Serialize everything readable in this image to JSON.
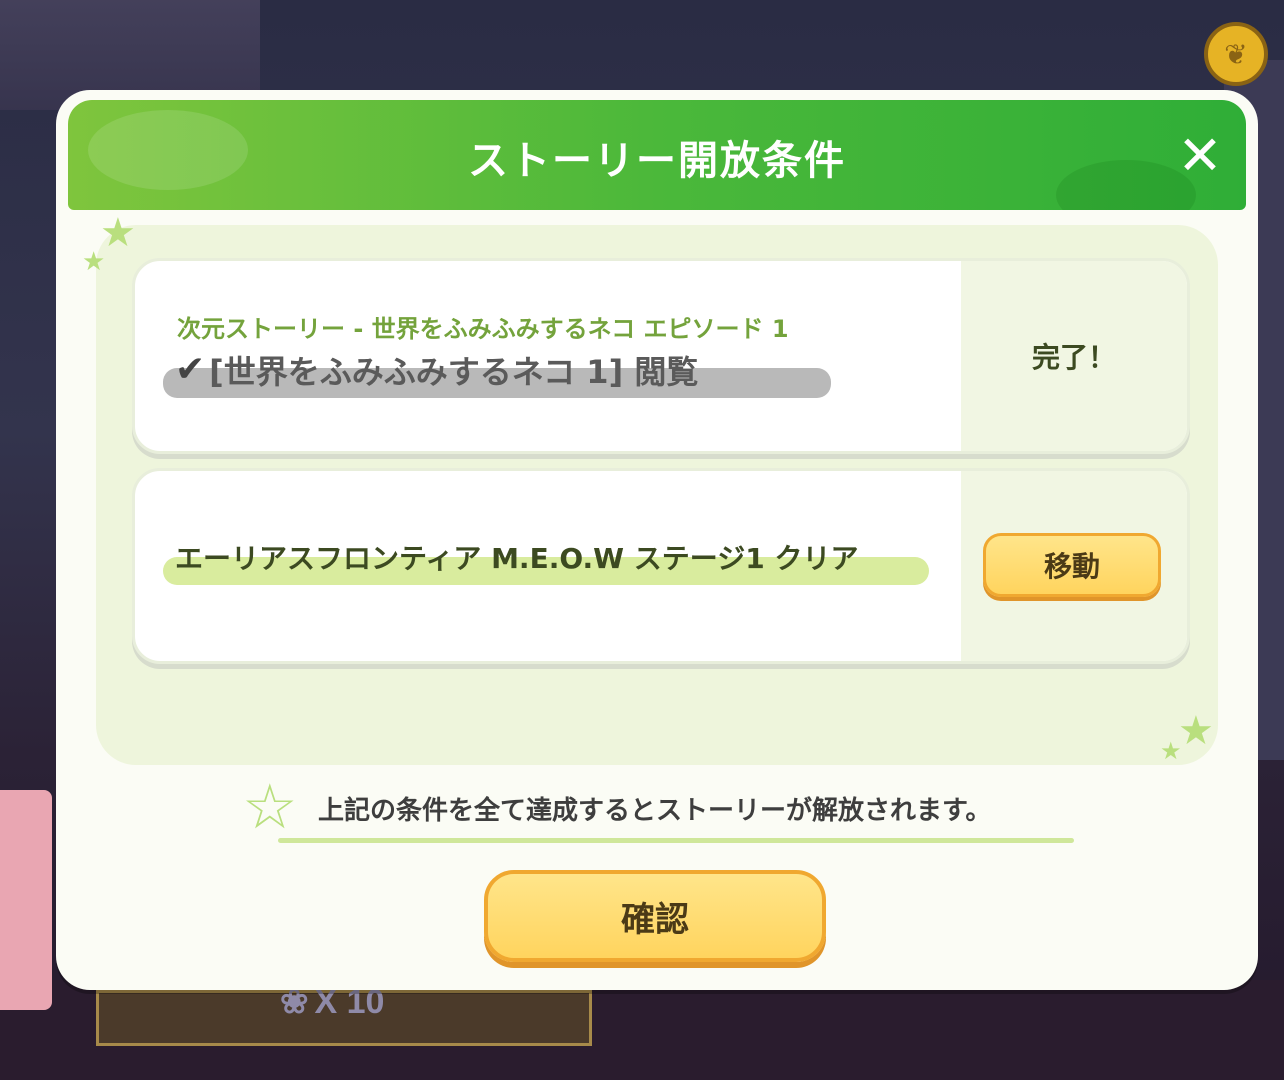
{
  "background": {
    "reward_text": "X 10"
  },
  "dialog": {
    "title": "ストーリー開放条件",
    "close_symbol": "✕",
    "conditions": [
      {
        "subtitle": "次元ストーリー - 世界をふみふみするネコ エピソード 1",
        "text": "[世界をふみふみするネコ 1] 閲覧",
        "status": "完了！",
        "icon": "check-icon"
      },
      {
        "text": "エーリアスフロンティア M.E.O.W ステージ1 クリア",
        "button": "移動"
      }
    ],
    "note": "上記の条件を全て達成するとストーリーが解放されます。",
    "confirm": "確認"
  },
  "colors": {
    "header_green": "#4bb83a",
    "panel_bg": "#eef5dc",
    "button_yellow": "#ffd45e",
    "accent_green": "#74a33c"
  }
}
